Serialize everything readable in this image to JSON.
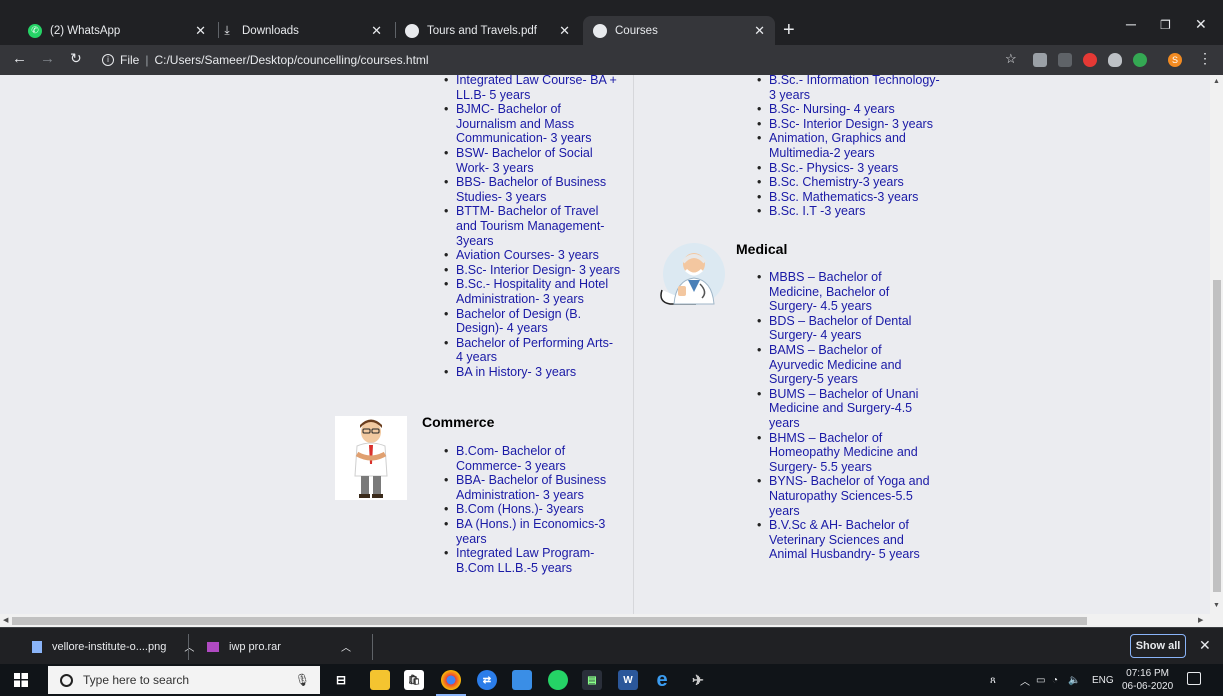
{
  "browser": {
    "tabs": [
      {
        "title": "(2) WhatsApp",
        "icon": "whatsapp-icon"
      },
      {
        "title": "Downloads",
        "icon": "download-icon"
      },
      {
        "title": "Tours and Travels.pdf",
        "icon": "chrome-icon"
      },
      {
        "title": "Courses",
        "icon": "chrome-icon",
        "active": true
      }
    ],
    "newtab": "+",
    "address": {
      "scheme_label": "File",
      "url": "C:/Users/Sameer/Desktop/councelling/courses.html"
    },
    "profile_initial": "S"
  },
  "page": {
    "left_list": [
      "Integrated Law Course- BA + LL.B- 5 years",
      "BJMC- Bachelor of Journalism and Mass Communication- 3 years",
      "BSW- Bachelor of Social Work- 3 years",
      "BBS- Bachelor of Business Studies- 3 years",
      "BTTM- Bachelor of Travel and Tourism Management- 3years",
      "Aviation Courses- 3 years",
      "B.Sc- Interior Design- 3 years",
      "B.Sc.- Hospitality and Hotel Administration- 3 years",
      "Bachelor of Design (B. Design)- 4 years",
      "Bachelor of Performing Arts- 4 years",
      "BA in History- 3 years"
    ],
    "commerce": {
      "title": "Commerce",
      "items": [
        "B.Com- Bachelor of Commerce- 3 years",
        "BBA- Bachelor of Business Administration- 3 years",
        "B.Com (Hons.)- 3years",
        "BA (Hons.) in Economics-3 years",
        "Integrated Law Program- B.Com LL.B.-5 years"
      ]
    },
    "right_list": [
      "B.Sc.- Information Technology- 3 years",
      "B.Sc- Nursing- 4 years",
      "B.Sc- Interior Design- 3 years",
      "Animation, Graphics and Multimedia-2 years",
      "B.Sc.- Physics- 3 years",
      "B.Sc. Chemistry-3 years",
      "B.Sc. Mathematics-3 years",
      "B.Sc. I.T -3 years"
    ],
    "medical": {
      "title": "Medical",
      "items": [
        "MBBS – Bachelor of Medicine, Bachelor of Surgery- 4.5 years",
        "BDS – Bachelor of Dental Surgery- 4 years",
        "BAMS – Bachelor of Ayurvedic Medicine and Surgery-5 years",
        "BUMS – Bachelor of Unani Medicine and Surgery-4.5 years",
        "BHMS – Bachelor of Homeopathy Medicine and Surgery- 5.5 years",
        "BYNS- Bachelor of Yoga and Naturopathy Sciences-5.5 years",
        "B.V.Sc & AH- Bachelor of Veterinary Sciences and Animal Husbandry- 5 years"
      ]
    }
  },
  "downloads": {
    "items": [
      "vellore-institute-o....png",
      "iwp pro.rar"
    ],
    "show_all": "Show all"
  },
  "taskbar": {
    "search_placeholder": "Type here to search",
    "tray_lang": "ENG",
    "time": "07:16 PM",
    "date": "06-06-2020"
  },
  "colors": {
    "link": "#1a1aa6",
    "page_bg": "#ebecf0",
    "chrome_dark": "#202124",
    "chrome_toolbar": "#35363a"
  }
}
